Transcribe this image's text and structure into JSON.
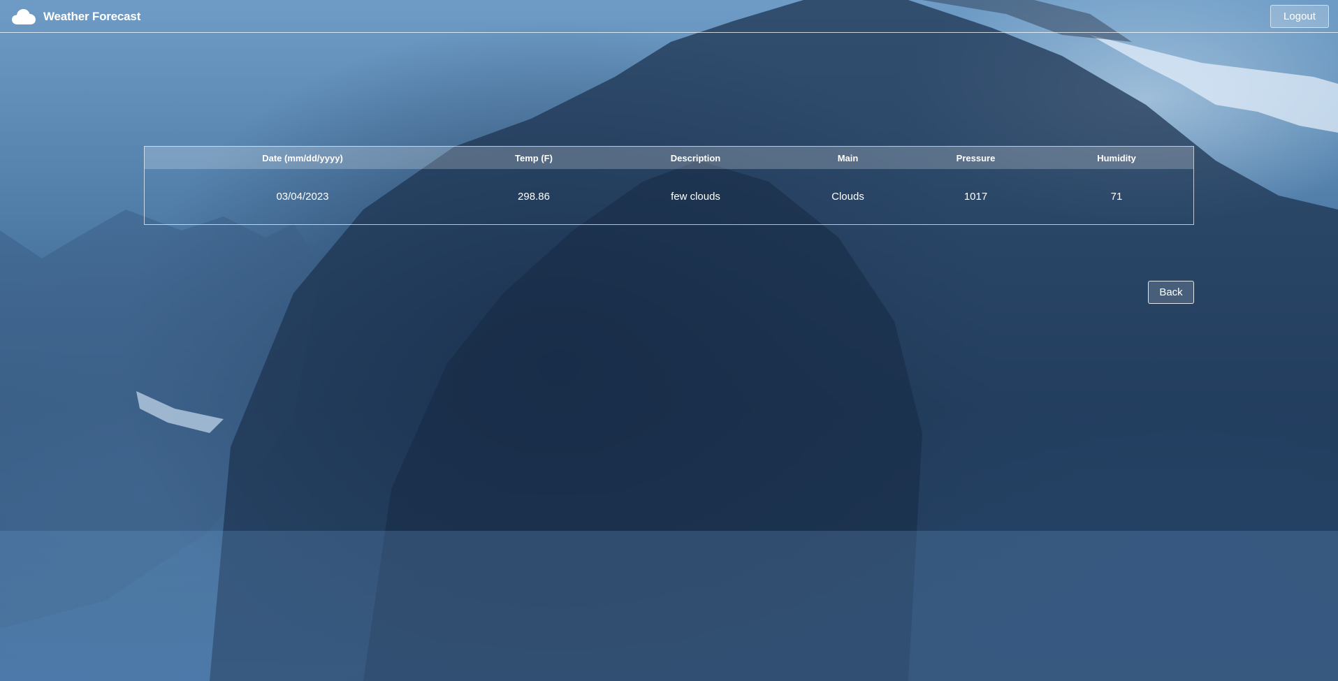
{
  "navbar": {
    "brand_icon": "cloud-icon",
    "title": "Weather Forecast",
    "logout_label": "Logout"
  },
  "table": {
    "headers": [
      "Date (mm/dd/yyyy)",
      "Temp (F)",
      "Description",
      "Main",
      "Pressure",
      "Humidity"
    ],
    "rows": [
      [
        "03/04/2023",
        "298.86",
        "few clouds",
        "Clouds",
        "1017",
        "71"
      ]
    ]
  },
  "actions": {
    "back_label": "Back"
  },
  "colors": {
    "text": "#ffffff",
    "background": "#4d7aa5"
  }
}
